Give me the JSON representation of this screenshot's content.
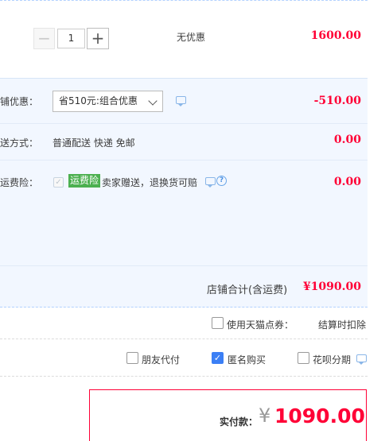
{
  "item": {
    "quantity": "1",
    "minus": "−",
    "plus": "+",
    "discount_text": "无优惠",
    "price": "1600.00"
  },
  "shop_discount": {
    "label": "铺优惠：",
    "select_value": "省510元:组合优惠",
    "amount": "-510.00"
  },
  "shipping": {
    "label": "送方式：",
    "value": "普通配送 快递 免邮",
    "amount": "0.00"
  },
  "insurance": {
    "label": "运费险：",
    "badge": "运费险",
    "text": "卖家赠送，退换货可赔",
    "help": "?",
    "amount": "0.00"
  },
  "shop_total": {
    "label": "店铺合计(含运费)",
    "amount": "¥1090.00"
  },
  "points": {
    "label": "使用天猫点券：",
    "note": "结算时扣除"
  },
  "options": {
    "friend_pay": "朋友代付",
    "anonymous": "匿名购买",
    "huabei": "花呗分期"
  },
  "payment": {
    "label": "实付款：",
    "currency": "¥",
    "amount": "1090.00"
  },
  "colors": {
    "accent_red": "#ff0036",
    "panel_blue": "#f2f7ff",
    "badge_green": "#4cb050",
    "checkbox_blue": "#3b7ff5"
  }
}
